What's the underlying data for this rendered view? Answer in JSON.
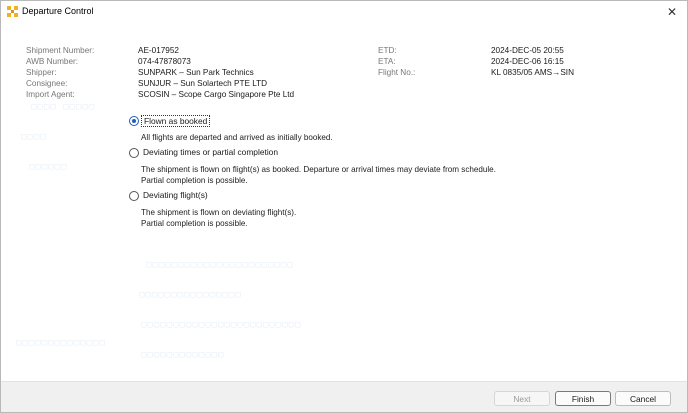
{
  "window": {
    "title": "Departure Control",
    "close_glyph": "✕"
  },
  "shipment": {
    "left": [
      {
        "label": "Shipment Number:",
        "value": "AE-017952"
      },
      {
        "label": "AWB Number:",
        "value": "074-47878073"
      },
      {
        "label": "Shipper:",
        "value": "SUNPARK – Sun Park Technics"
      },
      {
        "label": "Consignee:",
        "value": "SUNJUR – Sun Solartech PTE LTD"
      },
      {
        "label": "Import Agent:",
        "value": "SCOSIN – Scope Cargo Singapore Pte Ltd"
      }
    ],
    "right": [
      {
        "label": "ETD:",
        "value": "2024-DEC-05 20:55"
      },
      {
        "label": "ETA:",
        "value": "2024-DEC-06 16:15"
      },
      {
        "label": "Flight No.:",
        "value": "KL 0835/05 AMS→SIN"
      }
    ]
  },
  "options": [
    {
      "label": "Flown as booked",
      "checked": true,
      "desc": [
        "All flights are departed and arrived as initially booked."
      ]
    },
    {
      "label": "Deviating times or partial completion",
      "checked": false,
      "desc": [
        "The shipment is flown on flight(s) as booked. Departure or arrival times may deviate from schedule.",
        "Partial completion is possible."
      ]
    },
    {
      "label": "Deviating flight(s)",
      "checked": false,
      "desc": [
        "The shipment is flown on deviating flight(s).",
        "Partial completion is possible."
      ]
    }
  ],
  "buttons": {
    "next": "Next",
    "finish": "Finish",
    "cancel": "Cancel"
  },
  "colors": {
    "accent": "#1f5fbf",
    "footer_bg": "#f0f0f0",
    "icon_yellow": "#f2b21b"
  }
}
